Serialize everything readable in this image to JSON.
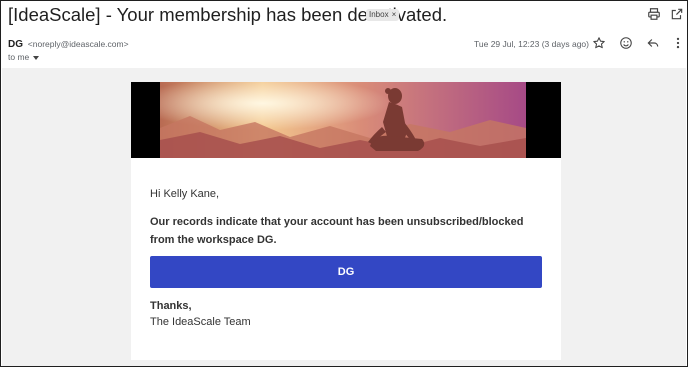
{
  "email": {
    "subject": "[IdeaScale] - Your membership has been deactivated.",
    "label_chip": "Inbox",
    "label_chip_close": "×",
    "sender_name": "DG",
    "sender_email": "<noreply@ideascale.com>",
    "recipient": "to me",
    "date": "Tue 29 Jul, 12:23 (3 days ago)"
  },
  "toolbar_icons": [
    "print-icon",
    "open-in-new-window-icon",
    "star-icon",
    "emoji-icon",
    "reply-icon",
    "more-vertical-icon"
  ],
  "body": {
    "greeting": "Hi Kelly Kane,",
    "message": "Our records indicate that your account has been unsubscribed/blocked from the workspace DG.",
    "button_label": "DG",
    "signoff": "Thanks,",
    "team": "The IdeaScale Team"
  }
}
